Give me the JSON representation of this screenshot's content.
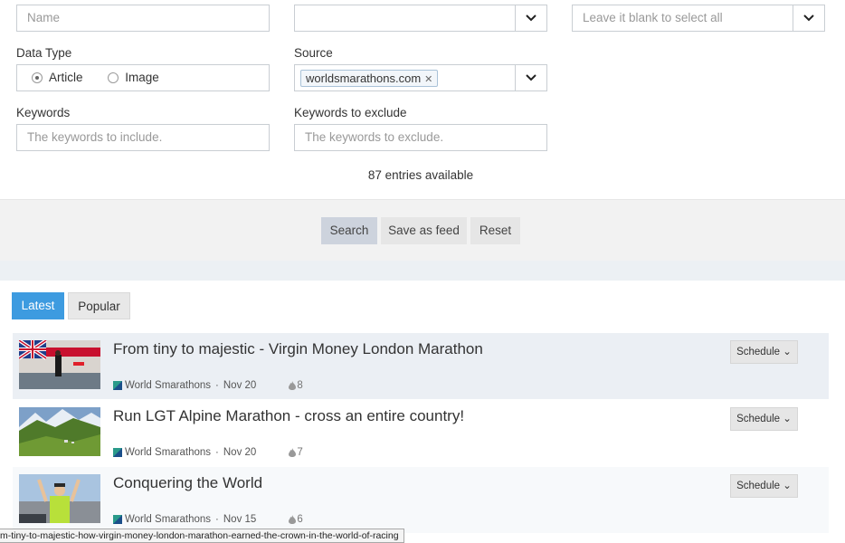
{
  "filters": {
    "name_placeholder": "Name",
    "blank_select_placeholder": "Leave it blank to select all",
    "data_type_label": "Data Type",
    "data_type_options": [
      "Article",
      "Image"
    ],
    "source_label": "Source",
    "source_tag": "worldsmarathons.com",
    "keywords_label": "Keywords",
    "keywords_placeholder": "The keywords to include.",
    "exclude_label": "Keywords to exclude",
    "exclude_placeholder": "The keywords to exclude.",
    "entries_text": "87 entries available"
  },
  "actions": {
    "search": "Search",
    "save_feed": "Save as feed",
    "reset": "Reset"
  },
  "tabs": {
    "latest": "Latest",
    "popular": "Popular"
  },
  "feed": [
    {
      "title": "From tiny to majestic - Virgin Money London Marathon",
      "source": "World Smarathons",
      "date": "Nov 20",
      "count": "8",
      "schedule": "Schedule"
    },
    {
      "title": "Run LGT Alpine Marathon - cross an entire country!",
      "source": "World Smarathons",
      "date": "Nov 20",
      "count": "7",
      "schedule": "Schedule"
    },
    {
      "title": "Conquering the World",
      "source": "World Smarathons",
      "date": "Nov 15",
      "count": "6",
      "schedule": "Schedule"
    }
  ],
  "status_url": "m-tiny-to-majestic-how-virgin-money-london-marathon-earned-the-crown-in-the-world-of-racing"
}
